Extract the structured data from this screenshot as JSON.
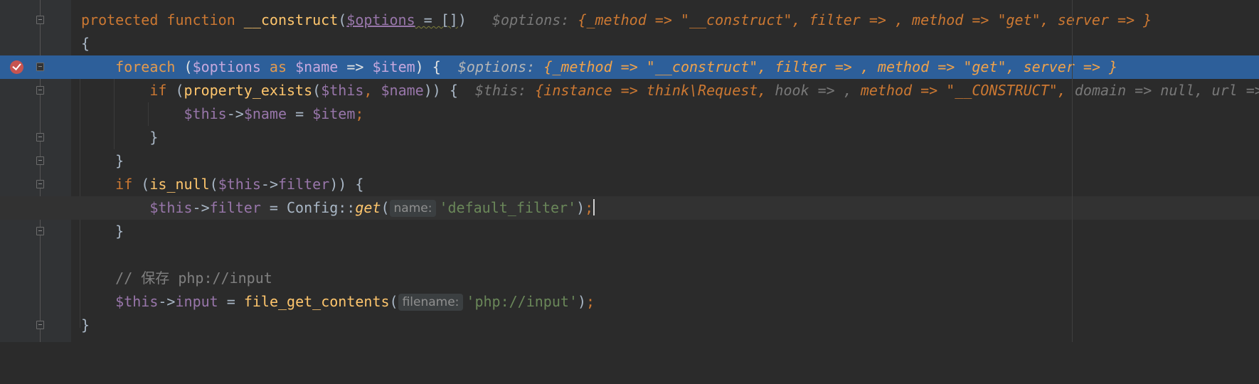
{
  "editor": {
    "lines": [
      {
        "l0_kw1": "protected",
        "l0_kw2": "function",
        "l0_fn": "__construct",
        "l0_p1": "(",
        "l0_var": "$options",
        "l0_p2": " = []",
        "l0_p3": ")",
        "l0_hk": "$options:",
        "l0_hv": "{_method => \"__construct\", filter => , method => \"get\", server => }"
      },
      {
        "l1": "{"
      },
      {
        "l2_kw1": "foreach",
        "l2_p1": " (",
        "l2_var1": "$options",
        "l2_kw2": " as ",
        "l2_var2": "$name",
        "l2_p2": " => ",
        "l2_var3": "$item",
        "l2_p3": ") {",
        "l2_hk": "$options:",
        "l2_hv": "{_method => \"__construct\", filter => , method => \"get\", server => }"
      },
      {
        "l3_kw": "if",
        "l3_p1": " (",
        "l3_fn": "property_exists",
        "l3_p2": "(",
        "l3_var1": "$this",
        "l3_kw2": ",",
        "l3_var2": " $name",
        "l3_p3": ")) {",
        "l3_hk": "$this:",
        "l3_hv1": "{instance => think\\Request,",
        "l3_hk2": " hook => ,",
        "l3_hv2": " method => \"__CONSTRUCT\",",
        "l3_hk3": " domain => null, url =>"
      },
      {
        "l4_var1": "$this",
        "l4_p1": "->",
        "l4_var2": "$name",
        "l4_p2": " = ",
        "l4_var3": "$item",
        "l4_kw": ";"
      },
      {
        "l5": "}"
      },
      {
        "l6": "}"
      },
      {
        "l7_kw": "if",
        "l7_p1": " (",
        "l7_fn": "is_null",
        "l7_p2": "(",
        "l7_var1": "$this",
        "l7_p3": "->",
        "l7_var2": "filter",
        "l7_p4": ")) {"
      },
      {
        "l8_var1": "$this",
        "l8_p1": "->",
        "l8_var2": "filter",
        "l8_p2": " = Config::",
        "l8_fn": "get",
        "l8_p3": "(",
        "l8_hint": "name:",
        "l8_str": "'default_filter'",
        "l8_p4": ")",
        "l8_kw": ";"
      },
      {
        "l9": "}"
      },
      {
        "l10": ""
      },
      {
        "l11_cm": "// 保存 php://input"
      },
      {
        "l12_var1": "$this",
        "l12_p1": "->",
        "l12_var2": "input",
        "l12_p2": " = ",
        "l12_fn": "file_get_contents",
        "l12_p3": "(",
        "l12_hint": "filename:",
        "l12_str": "'php://input'",
        "l12_p4": ")",
        "l12_kw": ";"
      },
      {
        "l13": "}"
      }
    ]
  }
}
